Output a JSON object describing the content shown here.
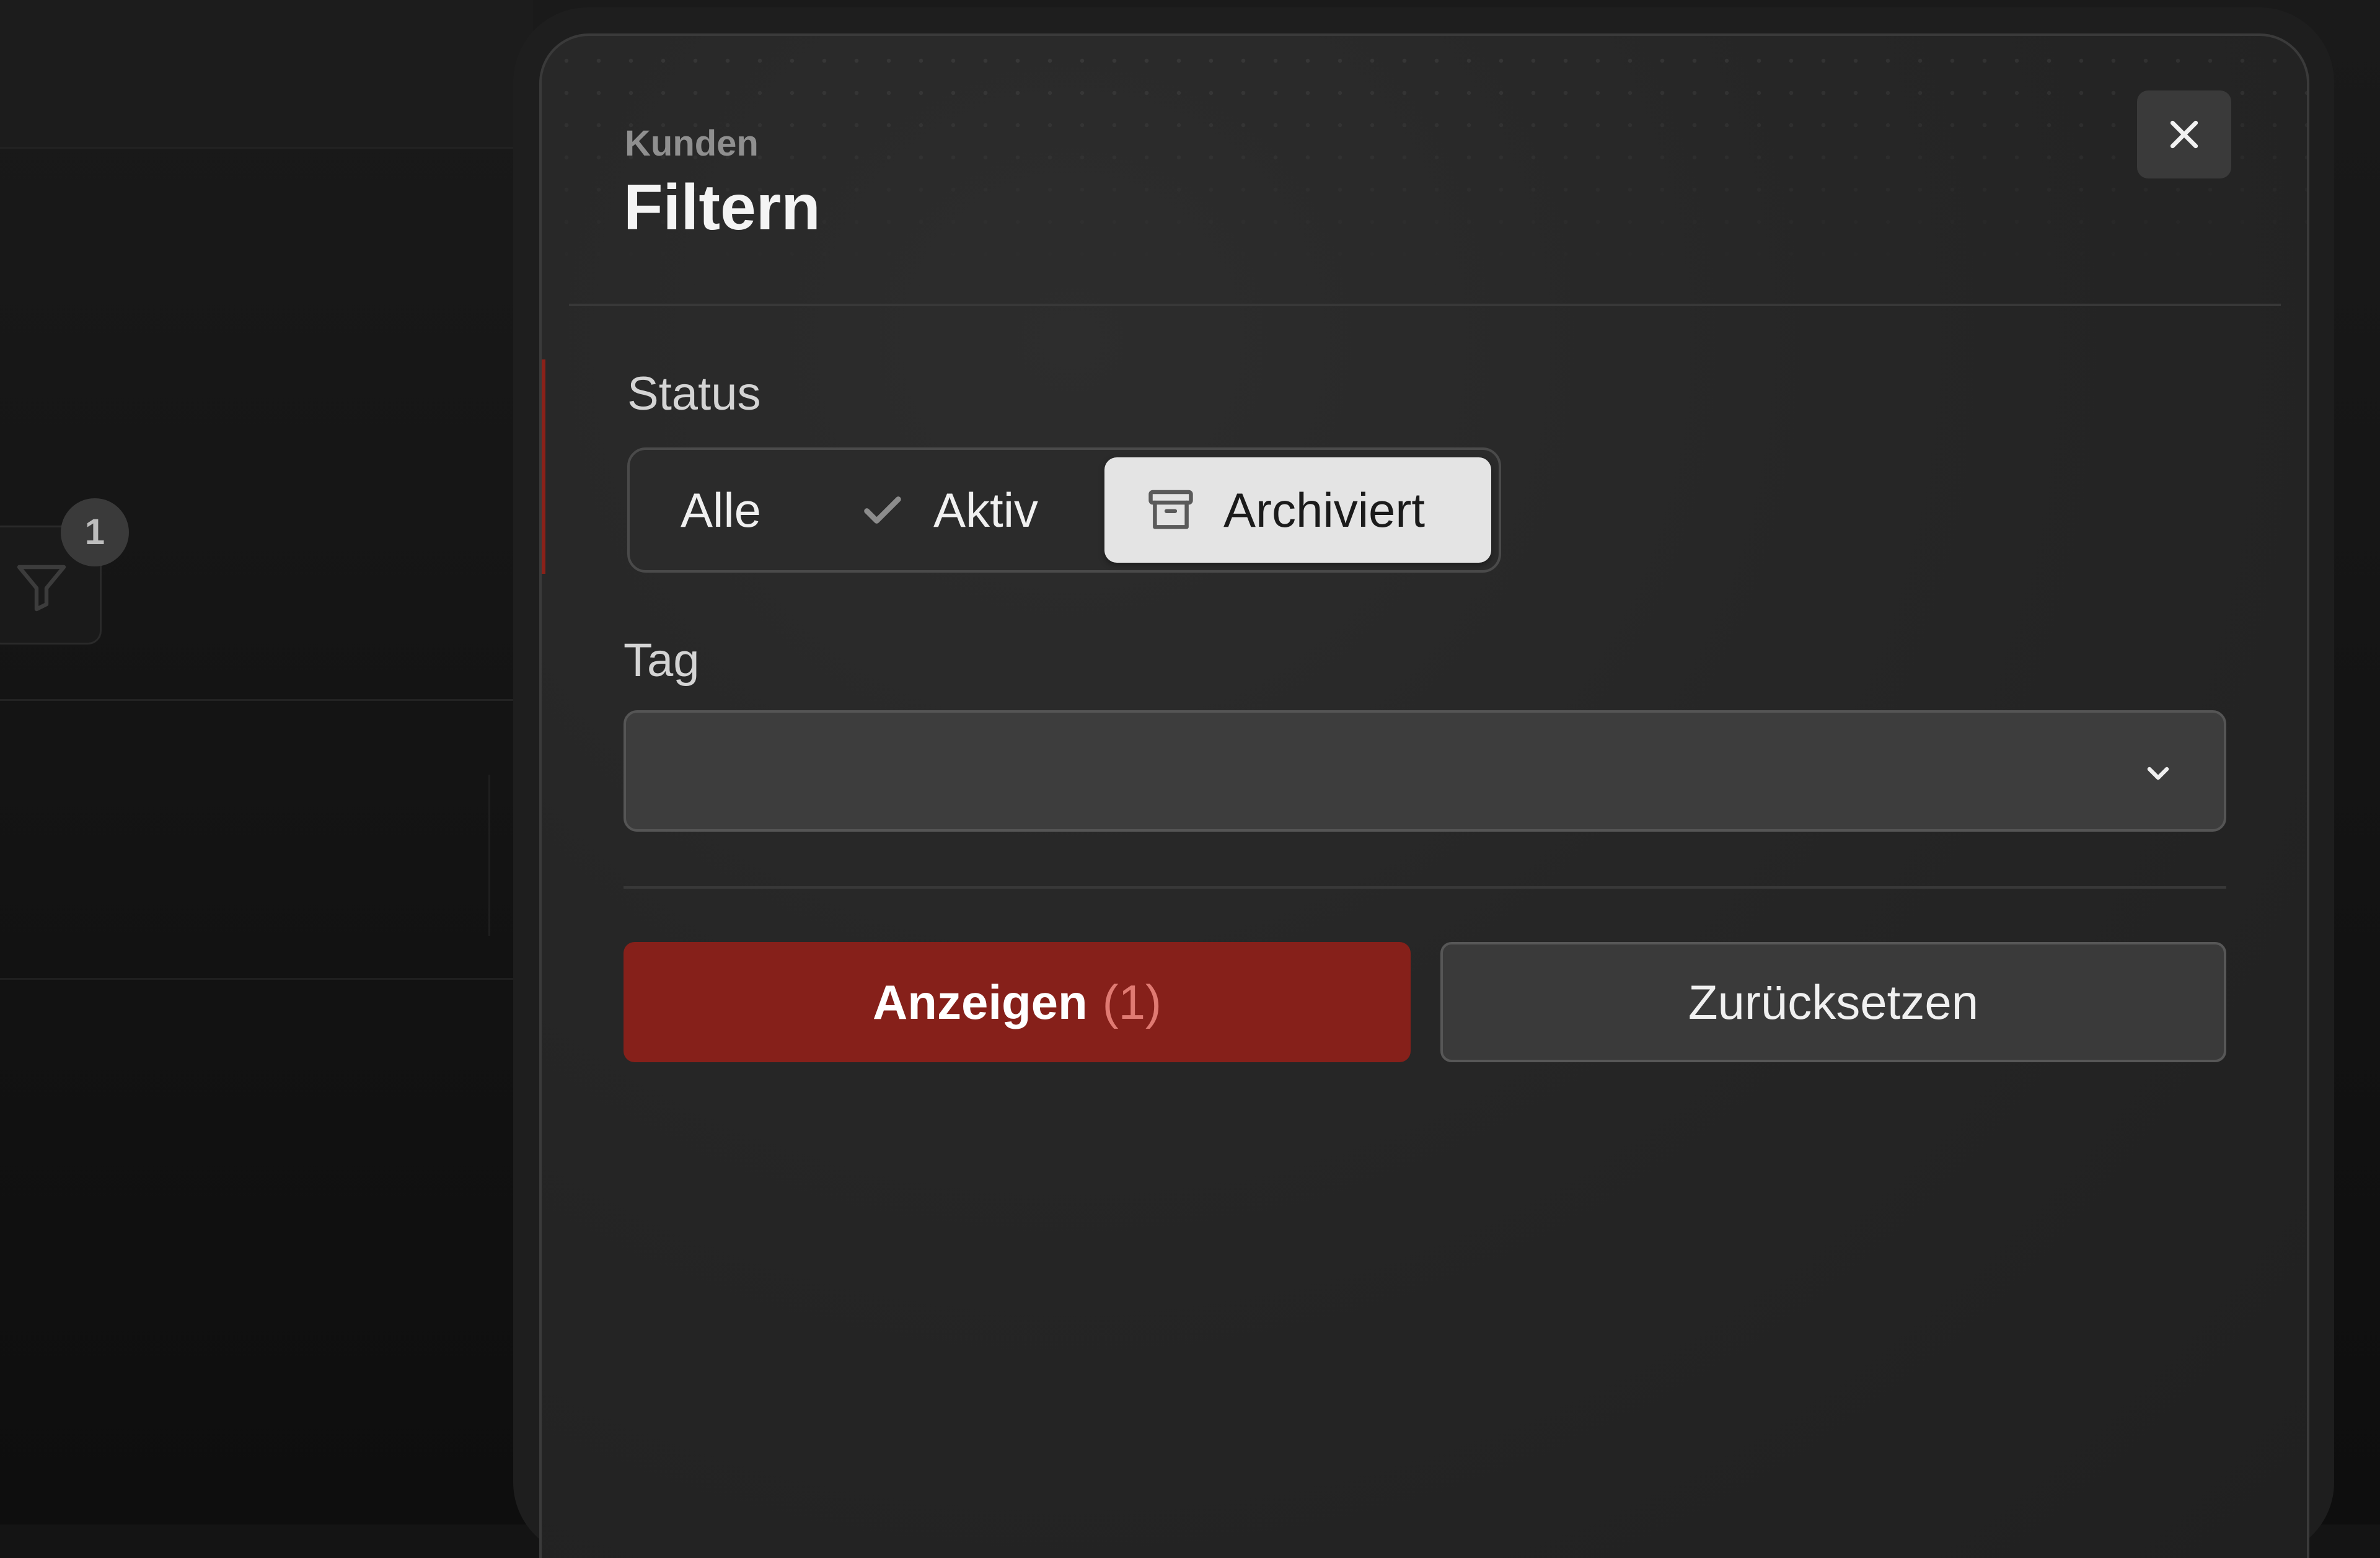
{
  "background": {
    "filter_badge_count": "1"
  },
  "modal": {
    "subtitle": "Kunden",
    "title": "Filtern",
    "accent_color": "#86201a"
  },
  "status": {
    "label": "Status",
    "options": [
      {
        "label": "Alle",
        "icon": "",
        "selected": false
      },
      {
        "label": "Aktiv",
        "icon": "check-icon",
        "selected": false
      },
      {
        "label": "Archiviert",
        "icon": "archive-icon",
        "selected": true
      }
    ]
  },
  "tag": {
    "label": "Tag",
    "value": ""
  },
  "actions": {
    "show_label": "Anzeigen",
    "show_count": "(1)",
    "reset_label": "Zurücksetzen"
  }
}
